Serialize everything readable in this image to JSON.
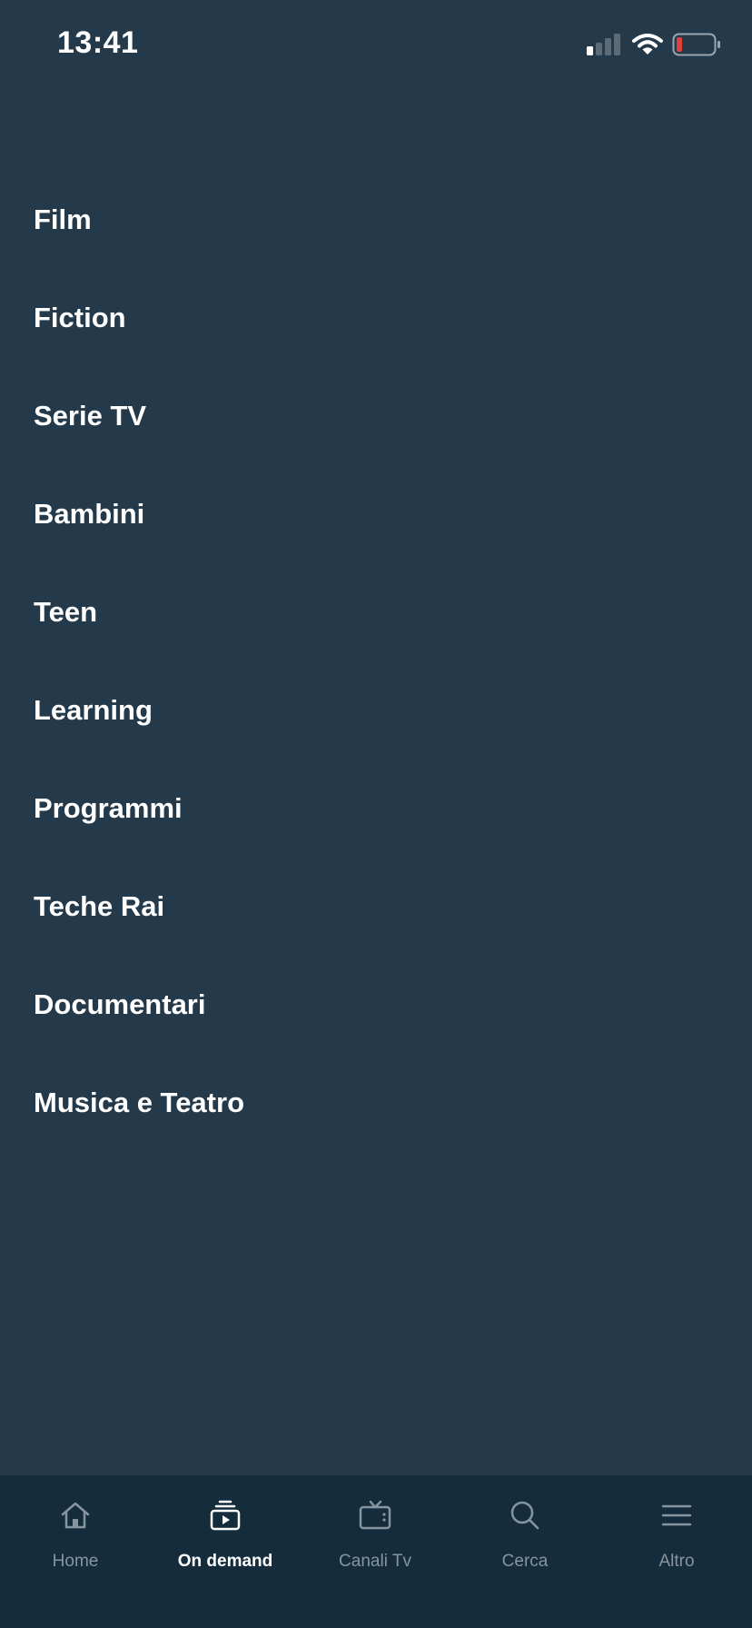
{
  "status_bar": {
    "time": "13:41",
    "icons": [
      "signal-icon",
      "wifi-icon",
      "battery-low-icon"
    ],
    "battery_color": "#e0403a"
  },
  "menu": {
    "items": [
      {
        "label": "Film"
      },
      {
        "label": "Fiction"
      },
      {
        "label": "Serie TV"
      },
      {
        "label": "Bambini"
      },
      {
        "label": "Teen"
      },
      {
        "label": "Learning"
      },
      {
        "label": "Programmi"
      },
      {
        "label": "Teche Rai"
      },
      {
        "label": "Documentari"
      },
      {
        "label": "Musica e Teatro"
      }
    ]
  },
  "tab_bar": {
    "active": "On demand",
    "tabs": [
      {
        "label": "Home",
        "icon": "home-icon"
      },
      {
        "label": "On demand",
        "icon": "on-demand-icon"
      },
      {
        "label": "Canali Tv",
        "icon": "tv-icon"
      },
      {
        "label": "Cerca",
        "icon": "search-icon"
      },
      {
        "label": "Altro",
        "icon": "menu-icon"
      }
    ]
  },
  "colors": {
    "background": "#243a4a",
    "tab_bar_background": "#142c3b",
    "text_primary": "#ffffff",
    "text_inactive": "#8695a0"
  }
}
